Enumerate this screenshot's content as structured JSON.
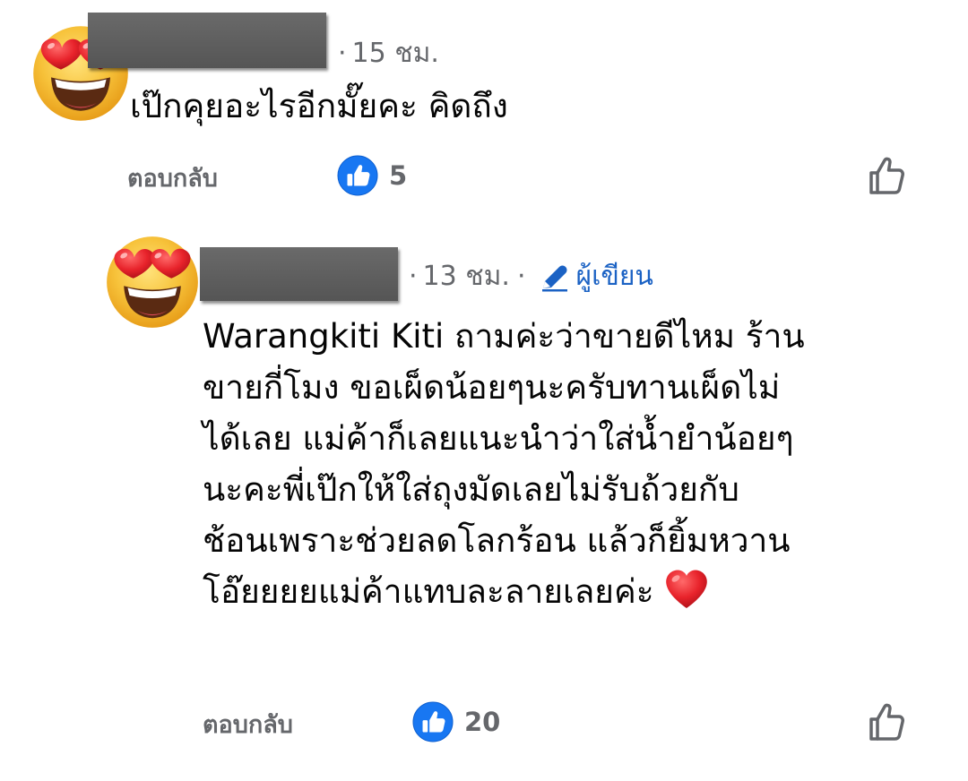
{
  "comment1": {
    "time": "15 ชม.",
    "text_lines": [
      "เป๊กคุยอะไรอีกมั๊ยคะ คิดถึง"
    ],
    "reply_label": "ตอบกลับ",
    "like_count": "5"
  },
  "comment2": {
    "time": "13 ชม.",
    "author_badge": "ผู้เขียน",
    "text_lines": [
      "Warangkiti Kiti ถามค่ะว่าขายดีไหม ร้าน",
      "ขายกี่โมง ขอเผ็ดน้อยๆนะครับทานเผ็ดไม่",
      "ได้เลย แม่ค้าก็เลยแนะนำว่าใส่น้ำยำน้อยๆ",
      "นะคะพี่เป๊กให้ใส่ถุงมัดเลยไม่รับถ้วยกับ",
      "ช้อนเพราะช่วยลดโลกร้อน แล้วก็ยิ้มหวาน",
      "โอ๊ยยยยแม่ค้าแทบละลายเลยค่ะ"
    ],
    "reply_label": "ตอบกลับ",
    "like_count": "20"
  },
  "icons": {
    "avatar": "heart-eyes-emoji-icon",
    "like_reaction": "thumbs-up-reaction-icon",
    "like_action": "thumbs-up-outline-icon",
    "author": "pencil-icon",
    "heart": "red-heart-emoji-icon"
  },
  "colors": {
    "accent_blue": "#1b62c4",
    "like_blue": "#1877f2",
    "meta_gray": "#65676b",
    "text": "#050505",
    "heart_red": "#e0242c"
  }
}
